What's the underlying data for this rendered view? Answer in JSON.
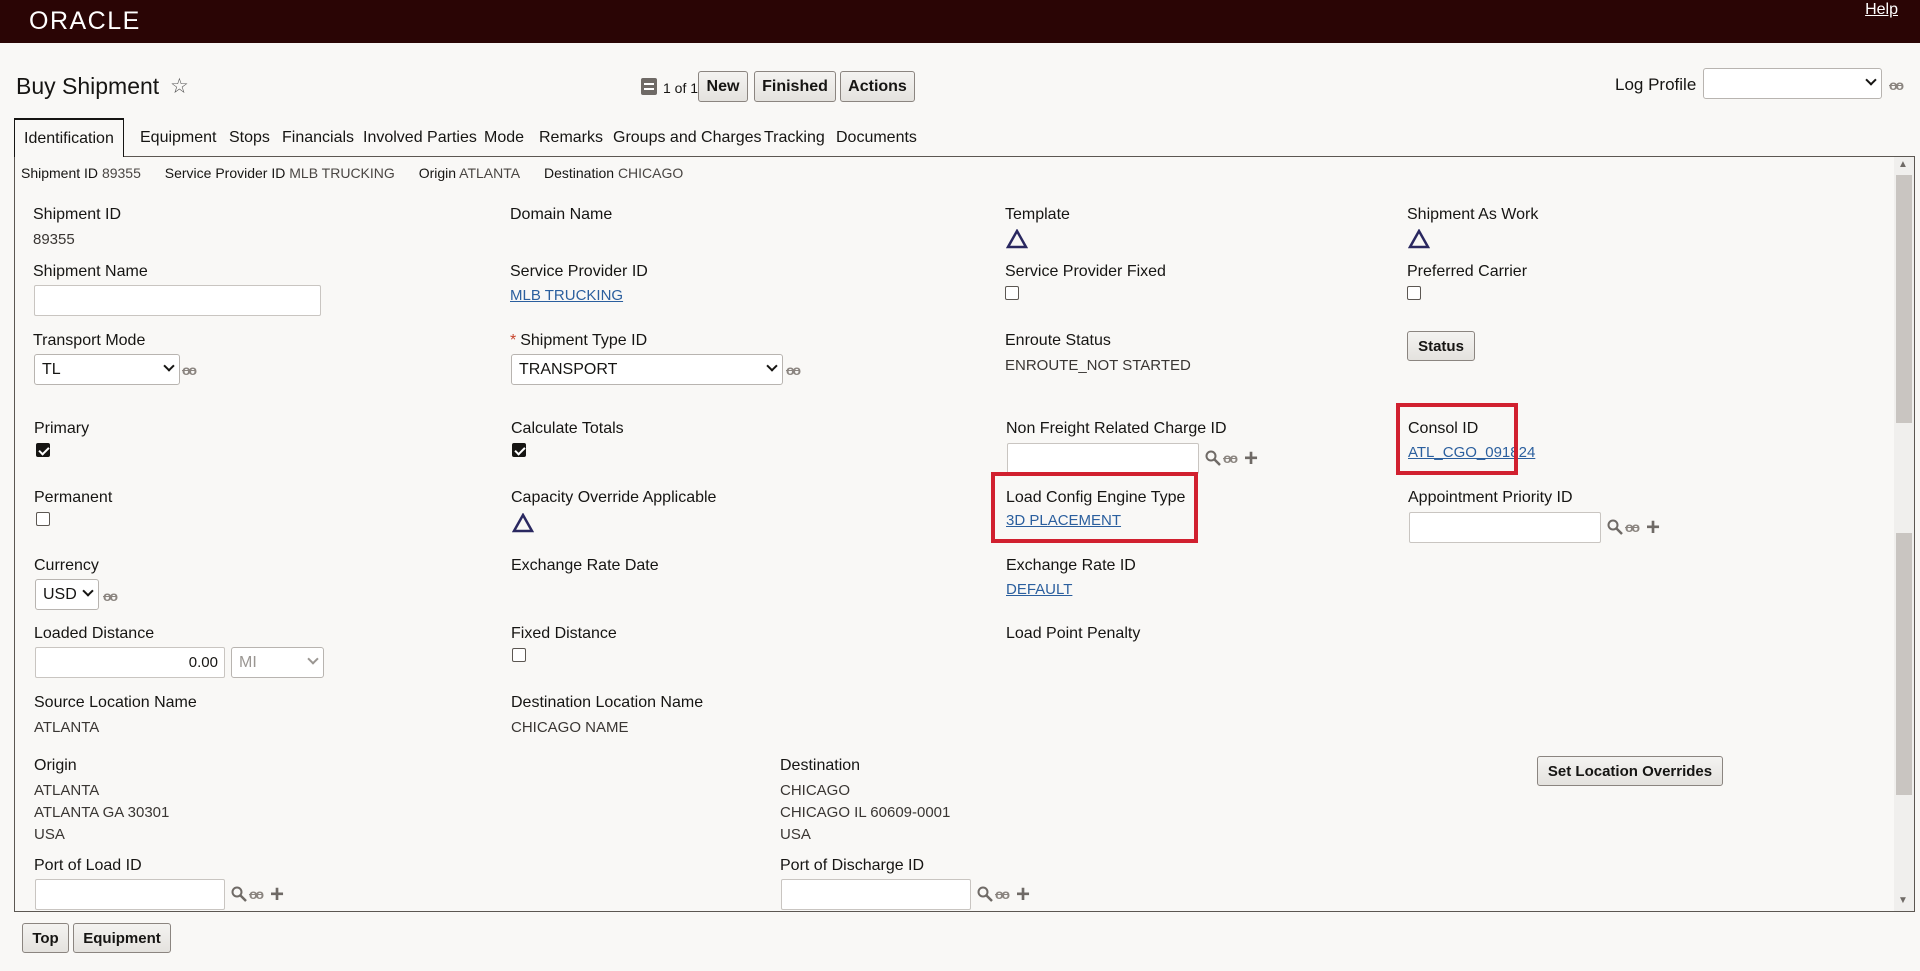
{
  "brand": "ORACLE",
  "help_label": "Help",
  "page": {
    "title": "Buy Shipment"
  },
  "toolbar": {
    "record_count": "1 of 1",
    "new_label": "New",
    "finished_label": "Finished",
    "actions_label": "Actions",
    "log_profile_label": "Log Profile",
    "log_profile_value": ""
  },
  "tabs": [
    "Identification",
    "Equipment",
    "Stops",
    "Financials",
    "Involved Parties",
    "Mode",
    "Remarks",
    "Groups and Charges",
    "Tracking",
    "Documents"
  ],
  "summary": {
    "shipment_id_label": "Shipment ID",
    "shipment_id": "89355",
    "service_provider_label": "Service Provider ID",
    "service_provider": "MLB TRUCKING",
    "origin_label": "Origin",
    "origin": "ATLANTA",
    "destination_label": "Destination",
    "destination": "CHICAGO"
  },
  "fields": {
    "shipment_id": {
      "label": "Shipment ID",
      "value": "89355"
    },
    "domain_name": {
      "label": "Domain Name"
    },
    "template": {
      "label": "Template"
    },
    "shipment_as_work": {
      "label": "Shipment As Work"
    },
    "shipment_name": {
      "label": "Shipment Name",
      "value": ""
    },
    "service_provider_id": {
      "label": "Service Provider ID",
      "value": "MLB TRUCKING"
    },
    "service_provider_fixed": {
      "label": "Service Provider Fixed"
    },
    "preferred_carrier": {
      "label": "Preferred Carrier"
    },
    "transport_mode": {
      "label": "Transport Mode",
      "value": "TL"
    },
    "shipment_type_id": {
      "required_mark": "*",
      "label": "Shipment Type ID",
      "value": "TRANSPORT"
    },
    "enroute_status": {
      "label": "Enroute Status",
      "value": "ENROUTE_NOT STARTED"
    },
    "status_button": "Status",
    "primary": {
      "label": "Primary"
    },
    "calculate_totals": {
      "label": "Calculate Totals"
    },
    "non_freight_charge": {
      "label": "Non Freight Related Charge ID",
      "value": ""
    },
    "consol_id": {
      "label": "Consol ID",
      "value": "ATL_CGO_091824"
    },
    "permanent": {
      "label": "Permanent"
    },
    "capacity_override": {
      "label": "Capacity Override Applicable"
    },
    "load_config_engine": {
      "label": "Load Config Engine Type",
      "value": "3D PLACEMENT"
    },
    "appointment_priority": {
      "label": "Appointment Priority ID",
      "value": ""
    },
    "currency": {
      "label": "Currency",
      "value": "USD"
    },
    "exchange_rate_date": {
      "label": "Exchange Rate Date"
    },
    "exchange_rate_id": {
      "label": "Exchange Rate ID",
      "value": "DEFAULT"
    },
    "loaded_distance": {
      "label": "Loaded Distance",
      "value": "0.00",
      "unit": "MI"
    },
    "fixed_distance": {
      "label": "Fixed Distance"
    },
    "load_point_penalty": {
      "label": "Load Point Penalty"
    },
    "source_location_name": {
      "label": "Source Location Name",
      "value": "ATLANTA"
    },
    "destination_location_name": {
      "label": "Destination Location Name",
      "value": "CHICAGO NAME"
    },
    "origin": {
      "label": "Origin",
      "line1": "ATLANTA",
      "line2": "ATLANTA GA 30301",
      "line3": "USA"
    },
    "destination": {
      "label": "Destination",
      "line1": "CHICAGO",
      "line2": "CHICAGO IL 60609-0001",
      "line3": "USA"
    },
    "set_location_overrides": "Set Location Overrides",
    "port_of_load": {
      "label": "Port of Load ID",
      "value": ""
    },
    "port_of_discharge": {
      "label": "Port of Discharge ID",
      "value": ""
    }
  },
  "footer": {
    "top_label": "Top",
    "equipment_label": "Equipment"
  },
  "checkbox_states": {
    "service_provider_fixed": false,
    "preferred_carrier": false,
    "primary": true,
    "calculate_totals": true,
    "permanent": false,
    "fixed_distance": false
  },
  "colors": {
    "banner": "#2a0505",
    "highlight": "#d1202f",
    "link": "#2b5f9e"
  },
  "icons": [
    "star-icon",
    "record-icon",
    "glasses-icon",
    "search-icon",
    "plus-icon",
    "triangle-icon"
  ]
}
